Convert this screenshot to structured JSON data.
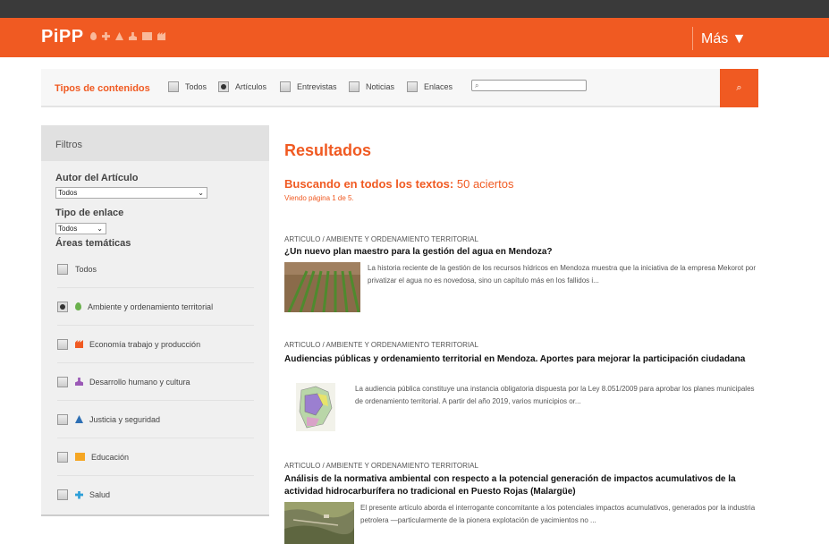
{
  "header": {
    "logo": "PiPP",
    "logo_icons": [
      "drop-icon",
      "plus-icon",
      "triangle-icon",
      "person-icon",
      "book-icon",
      "factory-icon"
    ],
    "more": "Más ▼"
  },
  "filterbar": {
    "title": "Tipos de contenidos",
    "options": [
      {
        "label": "Todos",
        "checked": false
      },
      {
        "label": "Artículos",
        "checked": true
      },
      {
        "label": "Entrevistas",
        "checked": false
      },
      {
        "label": "Noticias",
        "checked": false
      },
      {
        "label": "Enlaces",
        "checked": false
      }
    ],
    "search_placeholder": "",
    "search_button": "⌕"
  },
  "sidebar": {
    "heading": "Filtros",
    "author_label": "Autor del Artículo",
    "author_value": "Todos",
    "link_type_label": "Tipo de enlace",
    "link_type_value": "Todos",
    "areas_label": "Áreas temáticas",
    "topics": [
      {
        "label": "Todos",
        "checked": false,
        "icon": "",
        "color": ""
      },
      {
        "label": "Ambiente y ordenamiento territorial",
        "checked": true,
        "icon": "drop-icon",
        "color": "#6ab04c"
      },
      {
        "label": "Economía trabajo y producción",
        "checked": false,
        "icon": "factory-icon",
        "color": "#f05a22"
      },
      {
        "label": "Desarrollo humano y cultura",
        "checked": false,
        "icon": "person-icon",
        "color": "#9b59b6"
      },
      {
        "label": "Justicia y seguridad",
        "checked": false,
        "icon": "triangle-icon",
        "color": "#2d6fb4"
      },
      {
        "label": "Educación",
        "checked": false,
        "icon": "book-icon",
        "color": "#f5a623"
      },
      {
        "label": "Salud",
        "checked": false,
        "icon": "plus-icon",
        "color": "#2e9fd8"
      }
    ]
  },
  "results": {
    "title": "Resultados",
    "search_label": "Buscando en todos los textos:",
    "search_count": "50 aciertos",
    "page_info": "Viendo página 1 de 5.",
    "items": [
      {
        "category": "ARTICULO / AMBIENTE Y ORDENAMIENTO TERRITORIAL",
        "title": "¿Un nuevo plan maestro para la gestión del agua en Mendoza?",
        "excerpt": "La historia reciente de la gestión de los recursos hídricos en Mendoza muestra que la iniciativa de la empresa Mekorot por privatizar el agua no es novedosa, sino un capítulo más en los fallidos i..."
      },
      {
        "category": "ARTICULO / AMBIENTE Y ORDENAMIENTO TERRITORIAL",
        "title": "Audiencias públicas y ordenamiento territorial en Mendoza. Aportes para mejorar la participación ciudadana",
        "excerpt": "La audiencia pública constituye una instancia obligatoria dispuesta por la Ley 8.051/2009 para aprobar los planes municipales de ordenamiento territorial. A partir del año 2019, varios municipios or..."
      },
      {
        "category": "ARTICULO / AMBIENTE Y ORDENAMIENTO TERRITORIAL",
        "title": "Análisis de la normativa ambiental con respecto a la potencial generación de impactos acumulativos de la actividad hidrocarburífera no tradicional en Puesto Rojas (Malargüe)",
        "excerpt": "El presente artículo aborda el interrogante concomitante a los potenciales impactos acumulativos, generados por la industria petrolera —particularmente de la pionera explotación de yacimientos no ..."
      }
    ]
  }
}
